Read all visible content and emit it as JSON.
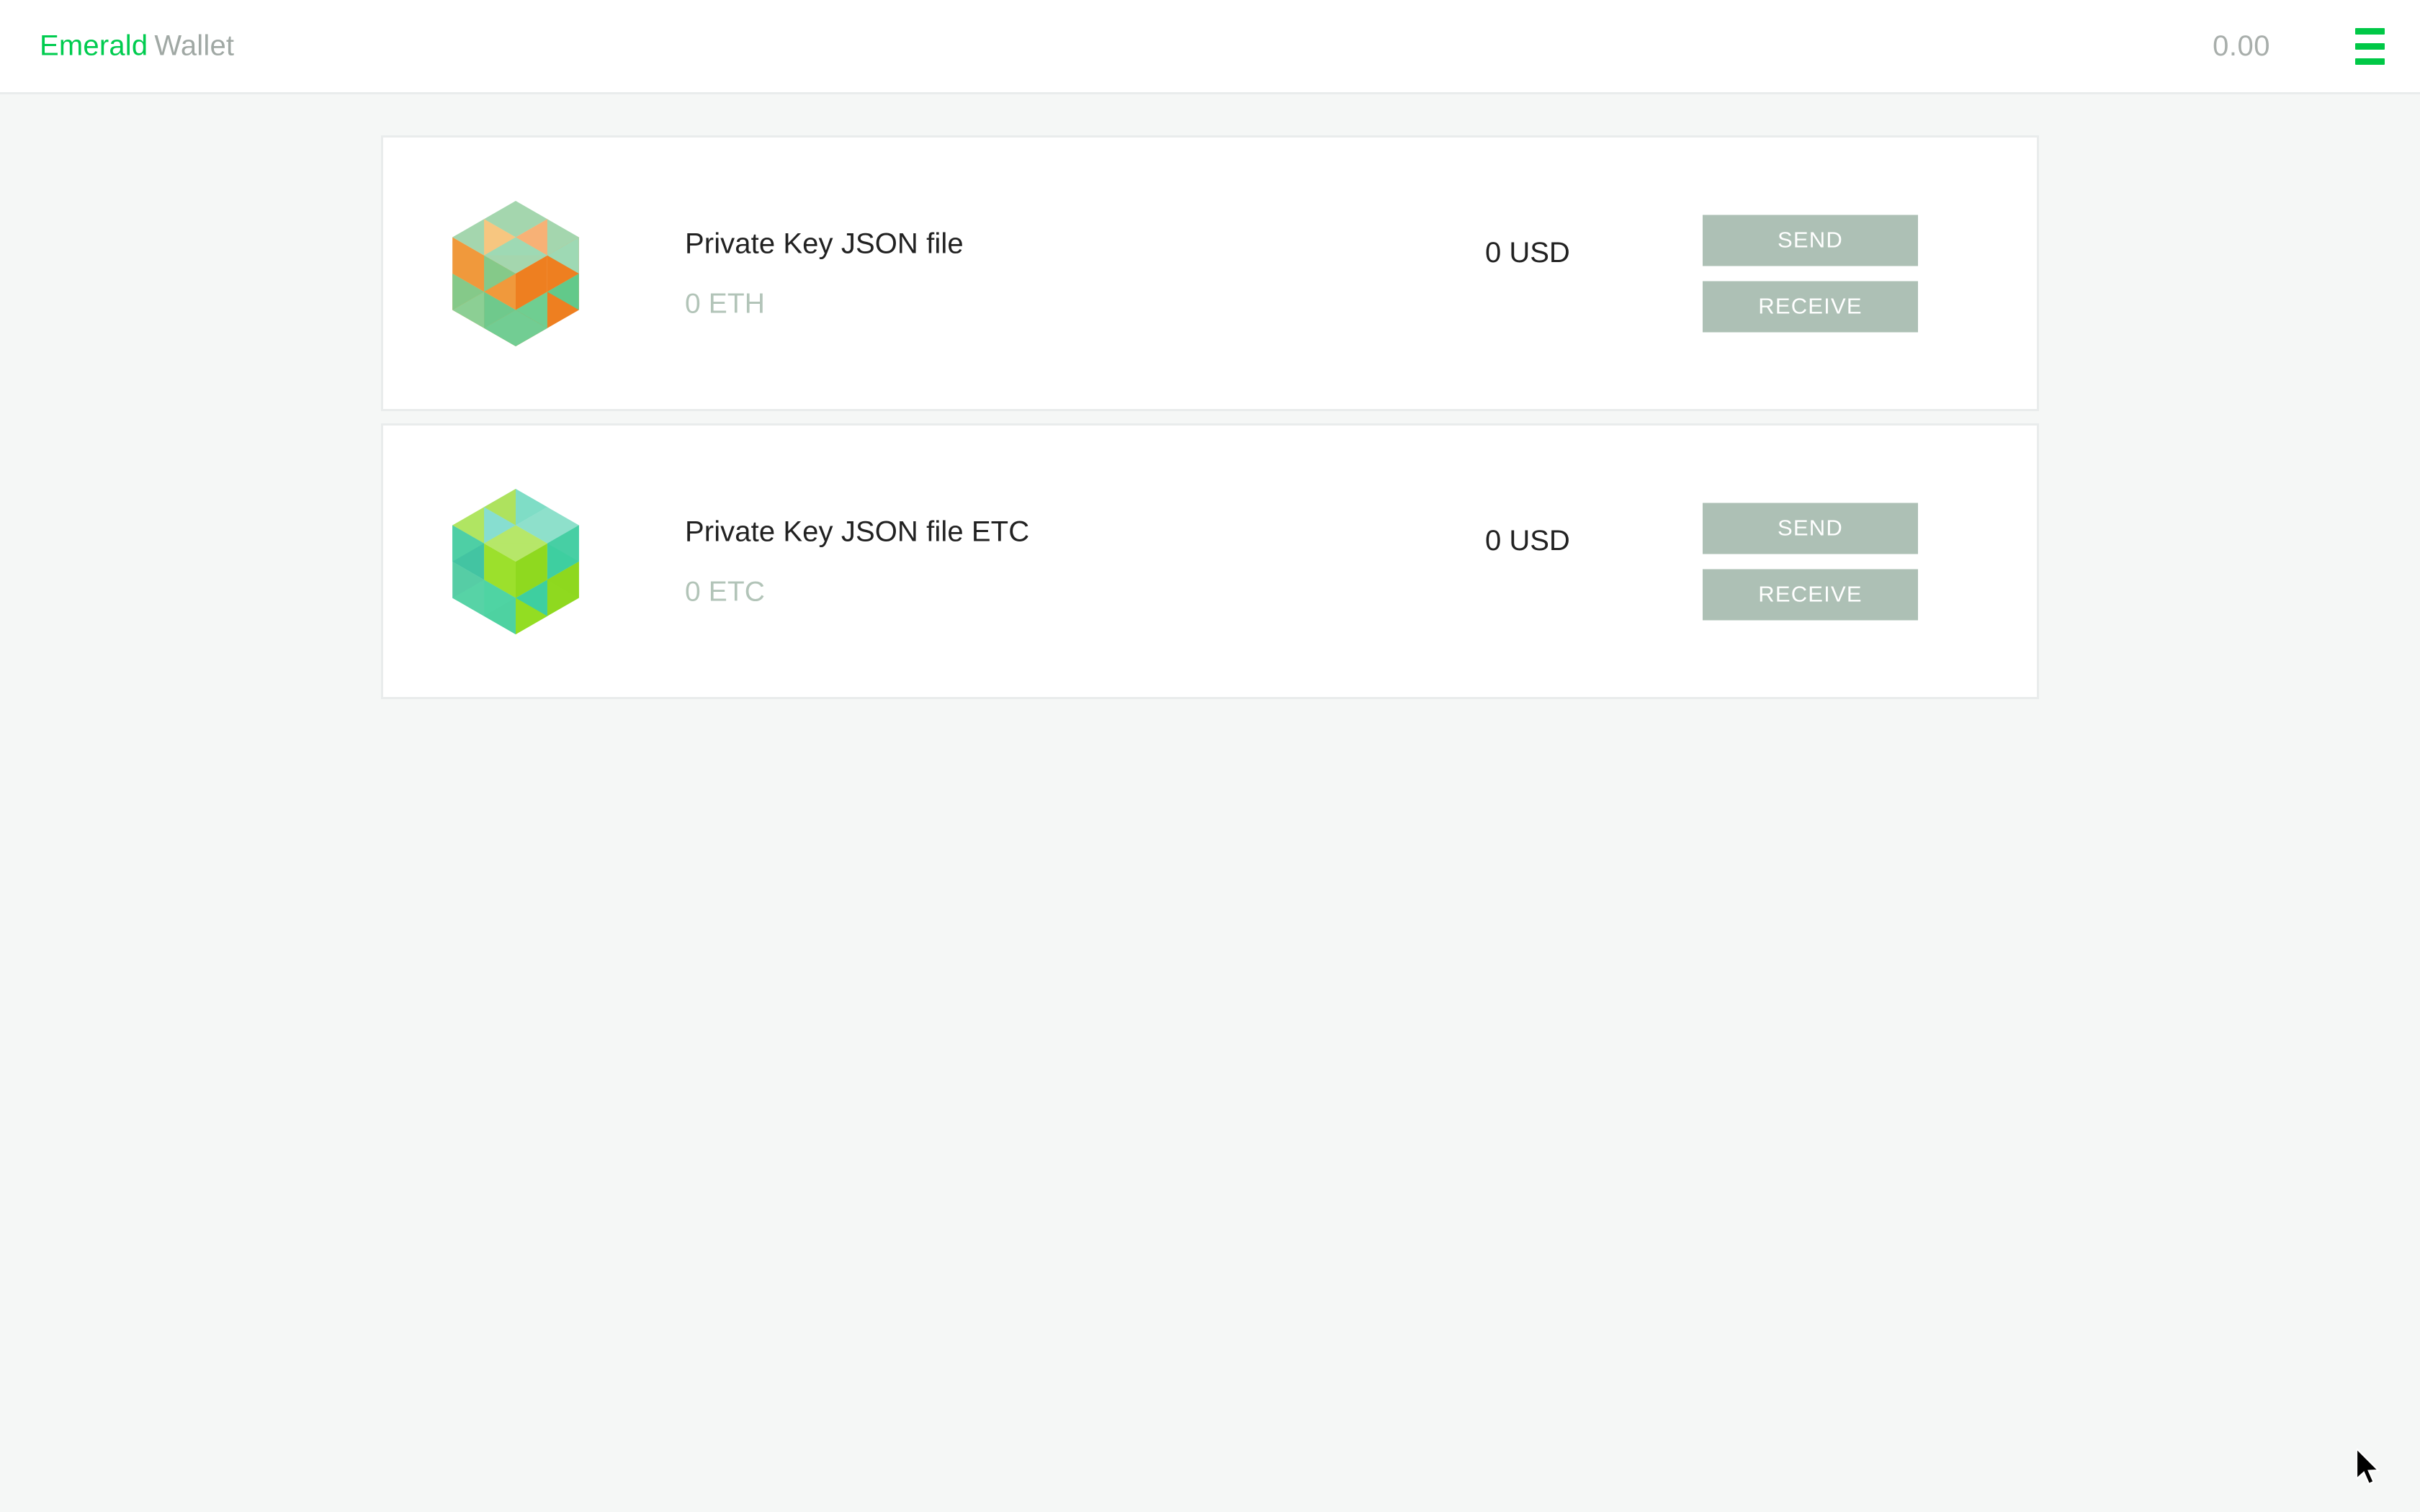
{
  "header": {
    "brand_primary": "Emerald",
    "brand_secondary": "Wallet",
    "total_balance": "0.00",
    "menu_icon": "hamburger-menu-icon"
  },
  "accounts": [
    {
      "icon": "emerald-cube-eth-icon",
      "name": "Private Key JSON file",
      "balance": "0 ETH",
      "fiat": "0 USD",
      "send_label": "SEND",
      "receive_label": "RECEIVE"
    },
    {
      "icon": "emerald-cube-etc-icon",
      "name": "Private Key JSON file ETC",
      "balance": "0 ETC",
      "fiat": "0 USD",
      "send_label": "SEND",
      "receive_label": "RECEIVE"
    }
  ],
  "colors": {
    "brand_green": "#00cc4f",
    "menu_green": "#00c846",
    "button_sage": "#adc0b5",
    "balance_sage": "#b2c4b8",
    "page_background": "#f5f7f6",
    "card_background": "#ffffff",
    "card_border": "#e9ecec",
    "text_dark": "#212121",
    "text_muted": "#a8aeab"
  }
}
